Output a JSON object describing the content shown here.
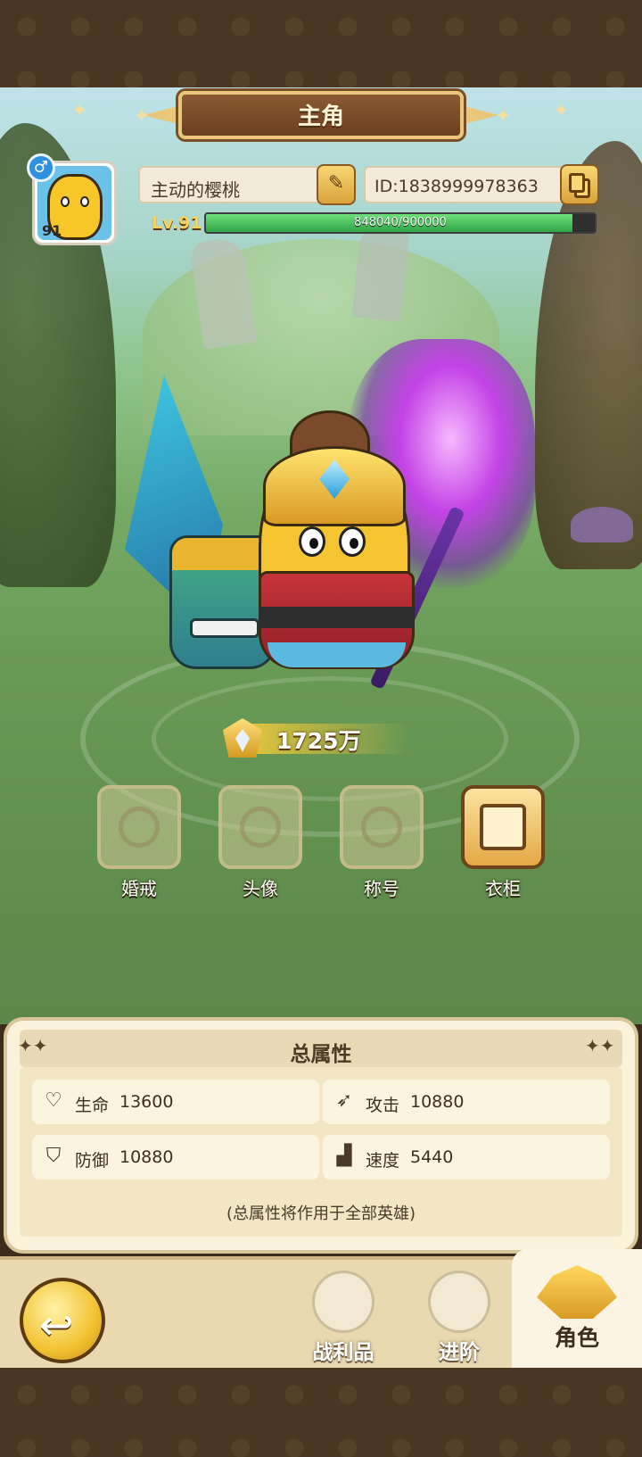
{
  "header": {
    "title": "主角"
  },
  "profile": {
    "avatar_level": "91",
    "gender_icon": "♂",
    "name": "主动的樱桃",
    "id_text": "ID:1838999978363",
    "level_text": "Lv.91",
    "xp_current": 848040,
    "xp_max": 900000,
    "xp_text": "848040/900000"
  },
  "power": {
    "value": "1725万"
  },
  "features": [
    {
      "label": "婚戒",
      "icon": "ring-icon",
      "active": false
    },
    {
      "label": "头像",
      "icon": "portrait-icon",
      "active": false
    },
    {
      "label": "称号",
      "icon": "title-crown-icon",
      "active": false
    },
    {
      "label": "衣柜",
      "icon": "wardrobe-icon",
      "active": true
    }
  ],
  "stats": {
    "title": "总属性",
    "items": [
      {
        "name": "生命",
        "value": "13600",
        "icon": "heart-icon"
      },
      {
        "name": "攻击",
        "value": "10880",
        "icon": "attack-icon"
      },
      {
        "name": "防御",
        "value": "10880",
        "icon": "shield-icon"
      },
      {
        "name": "速度",
        "value": "5440",
        "icon": "boot-icon"
      }
    ],
    "note": "(总属性将作用于全部英雄)"
  },
  "nav": {
    "back_icon": "back-arrow-icon",
    "items": [
      {
        "label": "战利品",
        "icon": "loot-icon"
      },
      {
        "label": "进阶",
        "icon": "sword-icon"
      },
      {
        "label": "角色",
        "icon": "character-icon",
        "active": true
      }
    ]
  }
}
